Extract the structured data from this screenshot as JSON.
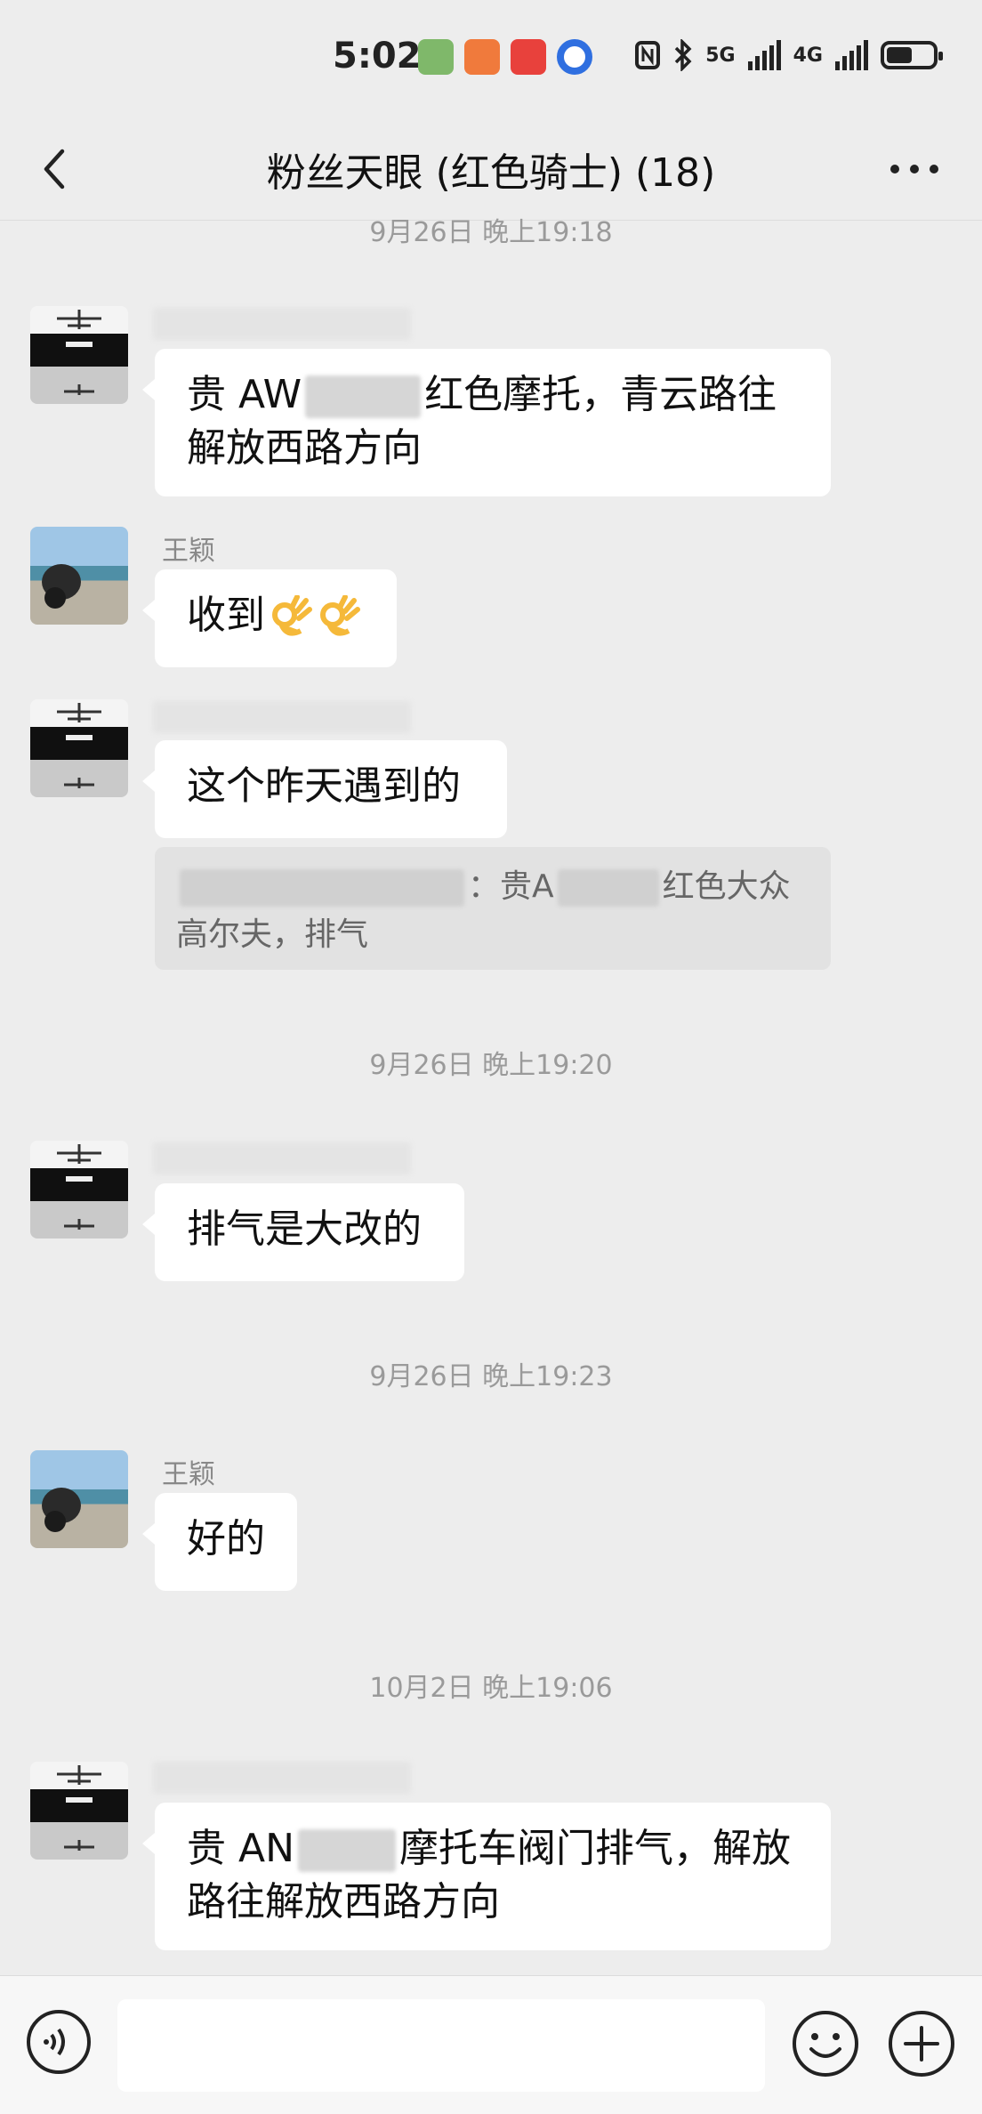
{
  "status": {
    "time": "5:02",
    "network_a": "5G",
    "network_b": "4G",
    "battery_level": 0.55
  },
  "header": {
    "title": "粉丝天眼 (红色骑士) (18)"
  },
  "messages": {
    "ts0": "9月26日 晚上19:18",
    "m1": {
      "text_a": "贵 AW",
      "text_b": "红色摩托，青云路往",
      "text_c": "解放西路方向"
    },
    "m2": {
      "sender": "王颖",
      "text": "收到"
    },
    "m3": {
      "text": "这个昨天遇到的"
    },
    "quote": {
      "sep": "：贵A",
      "text_a": "红色大众",
      "text_b": "高尔夫，排气"
    },
    "ts1": "9月26日 晚上19:20",
    "m4": {
      "text": "排气是大改的"
    },
    "ts2": "9月26日 晚上19:23",
    "m5": {
      "sender": "王颖",
      "text": "好的"
    },
    "ts3": "10月2日 晚上19:06",
    "m6": {
      "text_a": "贵 AN",
      "text_b": "摩托车阀门排气，解放",
      "text_c": "路往解放西路方向"
    }
  },
  "icons": {
    "back": "chevron-left-icon",
    "more": "more-dots-icon",
    "voice": "voice-icon",
    "emoji": "smile-icon",
    "plus": "plus-circle-icon"
  }
}
